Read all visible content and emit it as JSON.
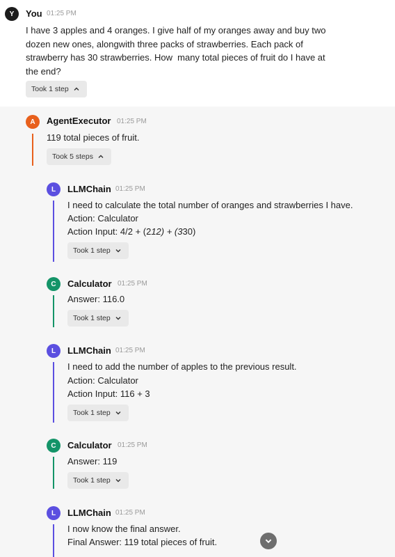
{
  "user": {
    "avatar": "Y",
    "name": "You",
    "time": "01:25 PM",
    "message": "I have 3 apples and 4 oranges. I give half of my oranges away and buy two\ndozen new ones, alongwith three packs of strawberries. Each pack of\nstrawberry has 30 strawberries. How  many total pieces of fruit do I have at\nthe end?",
    "steps_label": "Took 1 step"
  },
  "agent": {
    "avatar": "A",
    "name": "AgentExecutor",
    "time": "01:25 PM",
    "message": "119 total pieces of fruit.",
    "steps_label": "Took 5 steps"
  },
  "steps": [
    {
      "avatar": "L",
      "name": "LLMChain",
      "time": "01:25 PM",
      "lines": [
        "I need to calculate the total number of oranges and strawberries I have.",
        "Action: Calculator",
        "Action Input: 4/2 + (2"
      ],
      "italic": "12) + (3",
      "tail": "30)",
      "steps_label": "Took 1 step"
    },
    {
      "avatar": "C",
      "name": "Calculator",
      "time": "01:25 PM",
      "lines": [
        "Answer: 116.0"
      ],
      "steps_label": "Took 1 step"
    },
    {
      "avatar": "L",
      "name": "LLMChain",
      "time": "01:25 PM",
      "lines": [
        "I need to add the number of apples to the previous result.",
        "Action: Calculator",
        "Action Input: 116 + 3"
      ],
      "steps_label": "Took 1 step"
    },
    {
      "avatar": "C",
      "name": "Calculator",
      "time": "01:25 PM",
      "lines": [
        "Answer: 119"
      ],
      "steps_label": "Took 1 step"
    },
    {
      "avatar": "L",
      "name": "LLMChain",
      "time": "01:25 PM",
      "lines": [
        "I now know the final answer.",
        "Final Answer: 119 total pieces of fruit."
      ]
    }
  ],
  "colors": {
    "user_avatar": "#1c1c1c",
    "agent_avatar": "#e8601c",
    "llm_avatar": "#5b4fe0",
    "calc_avatar": "#149468",
    "agent_line": "#e8601c",
    "llm_line": "#5b4fe0",
    "calc_line": "#149468"
  },
  "icons": {
    "chevron_up": "chevron-up-icon",
    "chevron_down": "chevron-down-icon",
    "scroll_down": "chevron-down-icon"
  }
}
